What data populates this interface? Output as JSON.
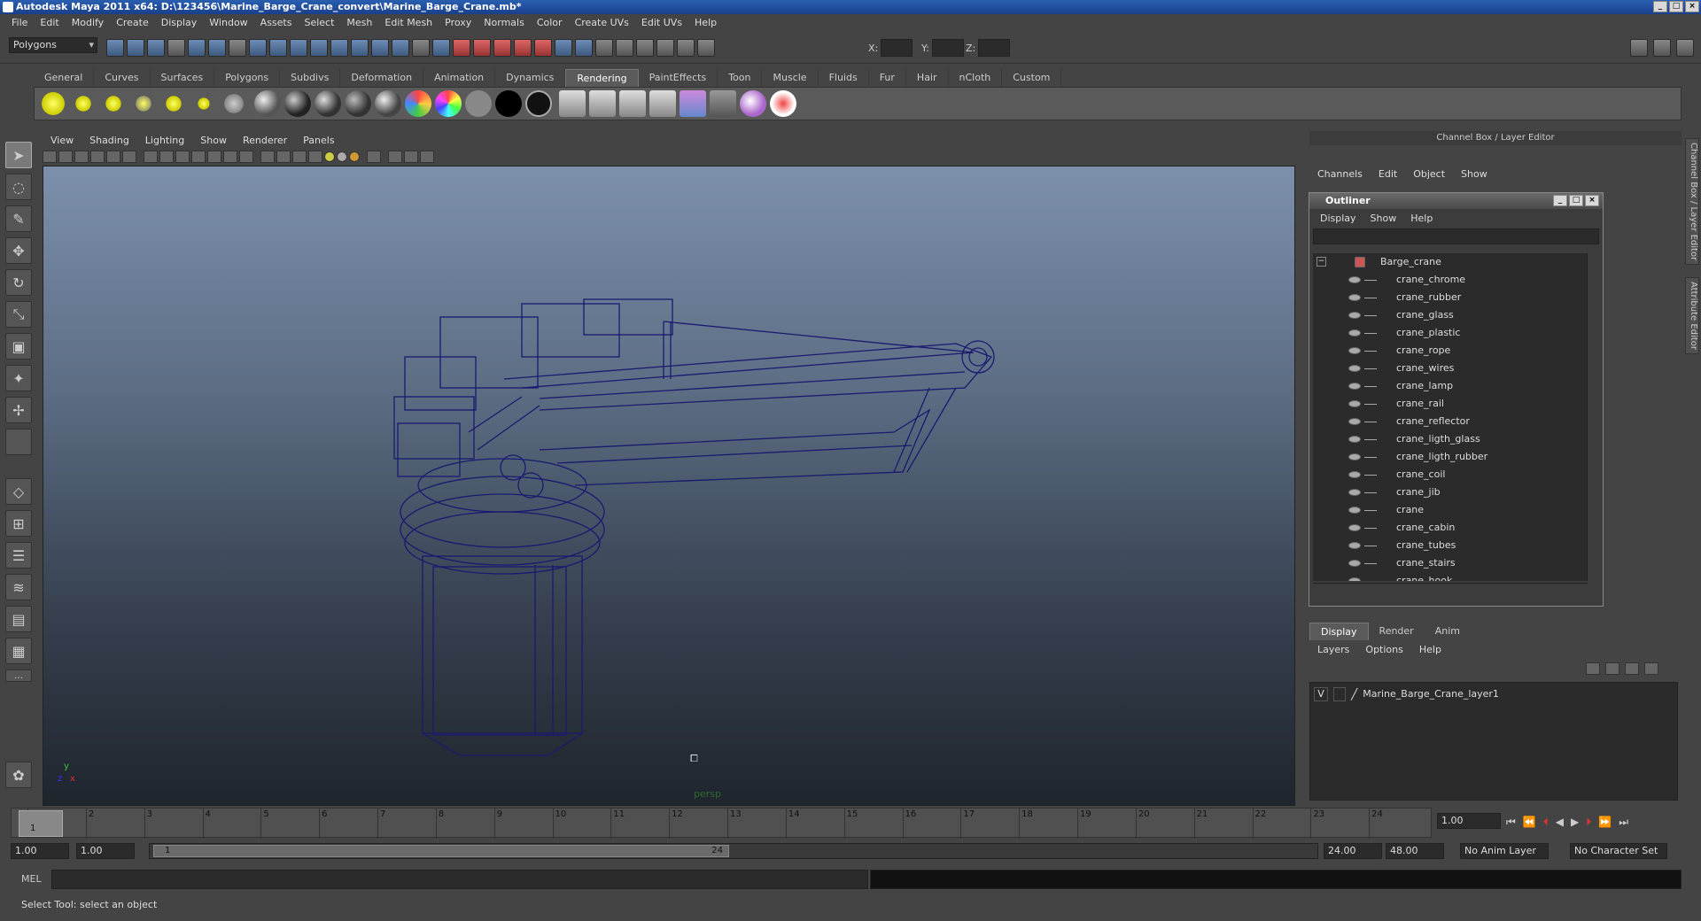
{
  "window": {
    "title": "Autodesk Maya 2011 x64: D:\\123456\\Marine_Barge_Crane_convert\\Marine_Barge_Crane.mb*",
    "buttons": [
      "_",
      "□",
      "×"
    ]
  },
  "menubar": {
    "items": [
      "File",
      "Edit",
      "Modify",
      "Create",
      "Display",
      "Window",
      "Assets",
      "Select",
      "Mesh",
      "Edit Mesh",
      "Proxy",
      "Normals",
      "Color",
      "Create UVs",
      "Edit UVs",
      "Help"
    ]
  },
  "statusline": {
    "mode": "Polygons",
    "coords": {
      "x_label": "X:",
      "y_label": "Y:",
      "z_label": "Z:"
    }
  },
  "shelf": {
    "tabs": [
      "General",
      "Curves",
      "Surfaces",
      "Polygons",
      "Subdivs",
      "Deformation",
      "Animation",
      "Dynamics",
      "Rendering",
      "PaintEffects",
      "Toon",
      "Muscle",
      "Fluids",
      "Fur",
      "Hair",
      "nCloth",
      "Custom"
    ],
    "active_tab": "Rendering"
  },
  "viewport": {
    "menu": [
      "View",
      "Shading",
      "Lighting",
      "Show",
      "Renderer",
      "Panels"
    ],
    "camera_label": "persp",
    "axis": {
      "y": "y",
      "x": "x",
      "z": "z"
    },
    "wire_color": "#1a1a6e"
  },
  "channelbox": {
    "header": "Channel Box / Layer Editor",
    "menu": [
      "Channels",
      "Edit",
      "Object",
      "Show"
    ]
  },
  "outliner": {
    "title": "Outliner",
    "menu": [
      "Display",
      "Show",
      "Help"
    ],
    "root": "Barge_crane",
    "items": [
      "crane_chrome",
      "crane_rubber",
      "crane_glass",
      "crane_plastic",
      "crane_rope",
      "crane_wires",
      "crane_lamp",
      "crane_rail",
      "crane_reflector",
      "crane_ligth_glass",
      "crane_ligth_rubber",
      "crane_coil",
      "crane_jib",
      "crane",
      "crane_cabin",
      "crane_tubes",
      "crane_stairs",
      "crane_hook"
    ]
  },
  "layer_editor": {
    "tabs": [
      "Display",
      "Render",
      "Anim"
    ],
    "active_tab": "Display",
    "menu": [
      "Layers",
      "Options",
      "Help"
    ],
    "layers": [
      {
        "visible": "V",
        "name": "Marine_Barge_Crane_layer1"
      }
    ]
  },
  "side_tabs": [
    "Channel Box / Layer Editor",
    "Attribute Editor"
  ],
  "timeslider": {
    "ticks": [
      "1",
      "2",
      "3",
      "4",
      "5",
      "6",
      "7",
      "8",
      "9",
      "10",
      "11",
      "12",
      "13",
      "14",
      "15",
      "16",
      "17",
      "18",
      "19",
      "20",
      "21",
      "22",
      "23",
      "24"
    ],
    "current_frame": "1.00",
    "current_marker": "1"
  },
  "range": {
    "start_time": "1.00",
    "playback_start": "1.00",
    "handle_start": "1",
    "handle_end": "24",
    "playback_end": "24.00",
    "end_time": "48.00",
    "anim_layer": "No Anim Layer",
    "character_set": "No Character Set"
  },
  "commandline": {
    "label": "MEL"
  },
  "helpline": {
    "text": "Select Tool: select an object"
  }
}
